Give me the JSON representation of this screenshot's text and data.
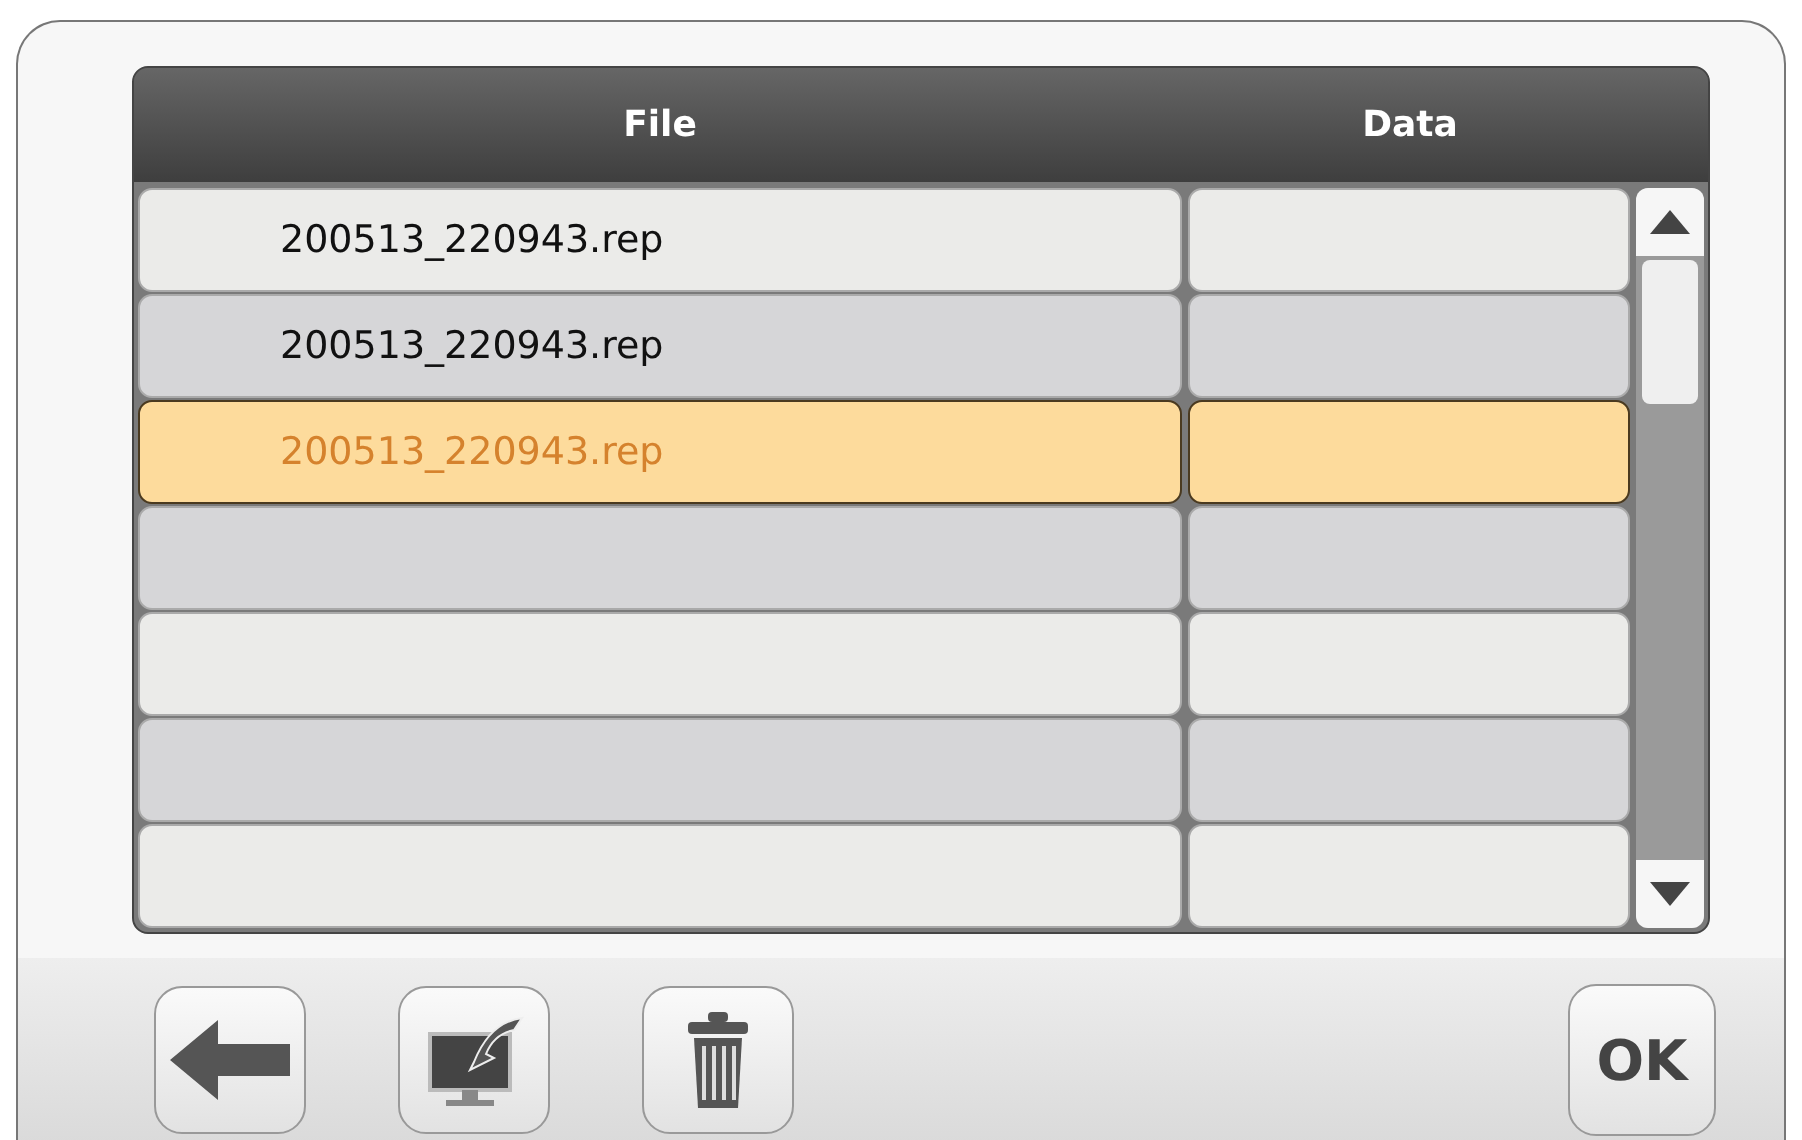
{
  "table": {
    "columns": [
      "File",
      "Data"
    ],
    "rows": [
      {
        "file": "200513_220943.rep",
        "selected": false
      },
      {
        "file": "200513_220943.rep",
        "selected": false
      },
      {
        "file": "200513_220943.rep",
        "selected": true
      },
      {
        "selected": false
      },
      {
        "selected": false
      },
      {
        "selected": false
      },
      {
        "selected": false
      }
    ]
  },
  "toolbar": {
    "buttons": [
      {
        "kind": "back"
      },
      {
        "kind": "export"
      },
      {
        "kind": "delete"
      }
    ],
    "ok": "OK"
  }
}
